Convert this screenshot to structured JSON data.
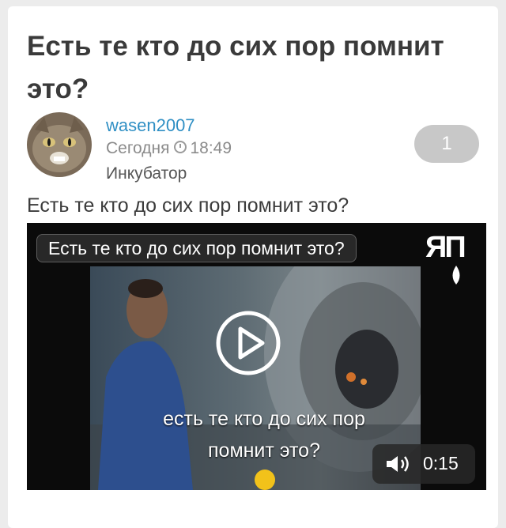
{
  "post": {
    "title": "Есть те кто до сих пор помнит это?",
    "author": "wasen2007",
    "date": "Сегодня",
    "time": "18:49",
    "community": "Инкубатор",
    "comment_count": "1",
    "text": "Есть те кто до сих пор помнит это?"
  },
  "video": {
    "caption": "Есть те кто до сих пор помнит это?",
    "logo": "ЯП",
    "subtitle_line1": "есть те кто до сих пор",
    "subtitle_line2": "помнит это?",
    "duration": "0:15"
  }
}
